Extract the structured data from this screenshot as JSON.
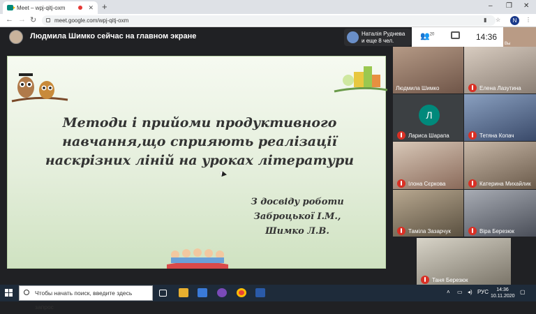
{
  "browser": {
    "tab_title": "Meet – wpj-qitj-oxm",
    "tab_close": "✕",
    "new_tab": "+",
    "url": "meet.google.com/wpj-qitj-oxm",
    "profile_initial": "N",
    "window_controls": [
      "–",
      "❐",
      "✕"
    ]
  },
  "meet": {
    "presenter_text": "Людмила Шимко сейчас на главном экране",
    "pinned_name": "Наталія Руднева",
    "pinned_more": "и еще 8 чел.",
    "people_count": "20",
    "time": "14:36",
    "self_label": "Вы"
  },
  "slide": {
    "title_line1": "Методи і прийоми продуктивного",
    "title_line2": "навчання,що сприяють реалізації",
    "title_line3": "наскрізних ліній на уроках літератури",
    "sub_line1": "З досвіду роботи",
    "sub_line2": "Заброцької І.М.,",
    "sub_line3": "Шимко Л.В."
  },
  "participants": [
    {
      "name": "Людмила Шимко",
      "muted": false,
      "color": "#8a6a58"
    },
    {
      "name": "Елена Лазутина",
      "muted": true,
      "color": "#9a8a7e"
    },
    {
      "name": "Лариса Шарапа",
      "muted": true,
      "avatar_letter": "Л"
    },
    {
      "name": "Тетяна Копач",
      "muted": true,
      "color": "#5a6a8a"
    },
    {
      "name": "Ілона Сєркова",
      "muted": true,
      "color": "#b0a090"
    },
    {
      "name": "Катерина Михайлик",
      "muted": true,
      "color": "#8a7a6a"
    },
    {
      "name": "Таміла Зазарчук",
      "muted": true,
      "color": "#7a7060"
    },
    {
      "name": "Віра Березюк",
      "muted": true,
      "color": "#6a6e78"
    },
    {
      "name": "Таня Березюк",
      "muted": true,
      "color": "#9a9488"
    }
  ],
  "taskbar": {
    "search_placeholder": "Чтобы начать поиск, введите здесь запрос",
    "lang": "РУС",
    "time": "14:36",
    "date": "10.11.2020"
  }
}
